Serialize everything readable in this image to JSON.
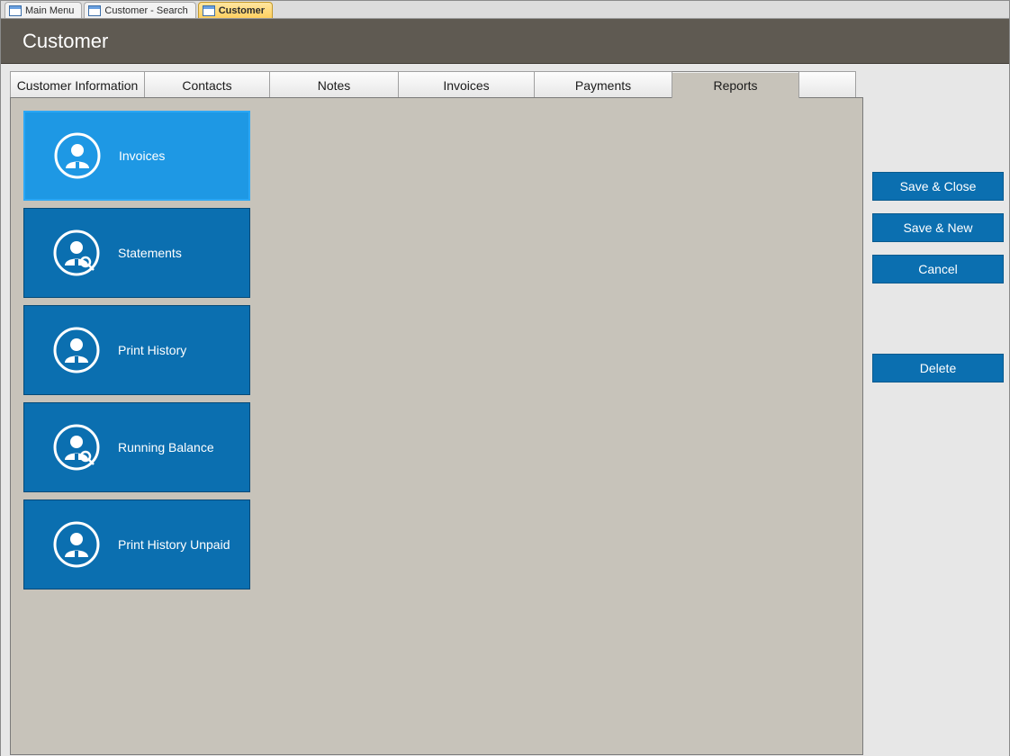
{
  "doc_tabs": [
    {
      "label": "Main Menu",
      "active": false
    },
    {
      "label": "Customer - Search",
      "active": false
    },
    {
      "label": "Customer",
      "active": true
    }
  ],
  "form_title": "Customer",
  "section_tabs": [
    {
      "label": "Customer Information",
      "active": false
    },
    {
      "label": "Contacts",
      "active": false
    },
    {
      "label": "Notes",
      "active": false
    },
    {
      "label": "Invoices",
      "active": false
    },
    {
      "label": "Payments",
      "active": false
    },
    {
      "label": "Reports",
      "active": true
    },
    {
      "label": "",
      "active": false
    }
  ],
  "report_tiles": [
    {
      "label": "Invoices",
      "selected": true,
      "icon": "person"
    },
    {
      "label": "Statements",
      "selected": false,
      "icon": "person-search"
    },
    {
      "label": "Print History",
      "selected": false,
      "icon": "person"
    },
    {
      "label": "Running Balance",
      "selected": false,
      "icon": "person-search"
    },
    {
      "label": "Print History Unpaid",
      "selected": false,
      "icon": "person"
    }
  ],
  "actions": {
    "save_close": "Save & Close",
    "save_new": "Save & New",
    "cancel": "Cancel",
    "delete": "Delete"
  }
}
